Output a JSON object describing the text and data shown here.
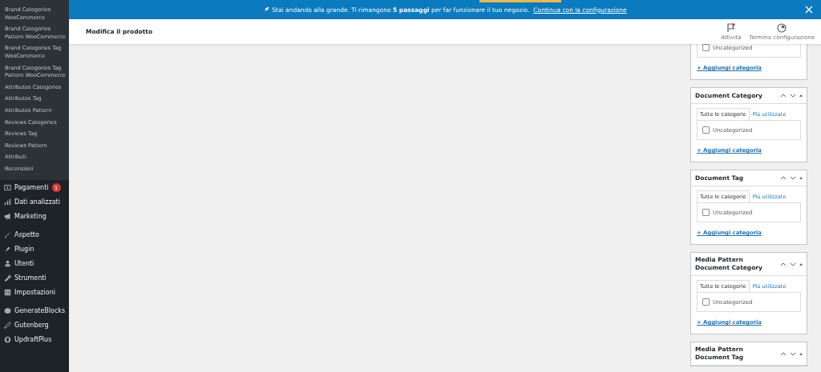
{
  "sidebar": {
    "submenu": [
      "Brand Categories WooCommerce",
      "Brand Categories Pattern WooCommerce",
      "Brand Categories Tag WooCommerce",
      "Brand Categories Tag Pattern WooCommerce",
      "Attributes Categories",
      "Attributes Tag",
      "Attributes Pattern",
      "Reviews Categories",
      "Reviews Tag",
      "Reviews Pattern",
      "Attributi",
      "Recensioni"
    ],
    "groups": [
      [
        {
          "label": "Pagamenti",
          "badge": "1"
        },
        {
          "label": "Dati analizzati"
        },
        {
          "label": "Marketing"
        }
      ],
      [
        {
          "label": "Aspetto"
        },
        {
          "label": "Plugin"
        },
        {
          "label": "Utenti"
        },
        {
          "label": "Strumenti"
        },
        {
          "label": "Impostazioni"
        }
      ],
      [
        {
          "label": "GenerateBlocks"
        },
        {
          "label": "Gutenberg"
        },
        {
          "label": "UpdraftPlus"
        }
      ]
    ]
  },
  "notice": {
    "text": "Stai andando alla grande. Ti rimangono **5 passaggi** per far funzionare il tuo negozio.",
    "link": "Continua con la configurazione"
  },
  "header": {
    "title": "Modifica il prodotto",
    "actions": [
      {
        "label": "Attività"
      },
      {
        "label": "Termina configurazione"
      }
    ]
  },
  "panels": [
    {
      "kind": "body_only",
      "items": [
        {
          "label": "Uncategorized",
          "checked": false
        }
      ],
      "add_link": "+ Aggiungi categoria"
    },
    {
      "kind": "full",
      "title": "Document Category",
      "tabs": [
        {
          "label": "Tutte le categorie",
          "selected": true
        },
        {
          "label": "Più utilizzate",
          "selected": false
        }
      ],
      "items": [
        {
          "label": "Uncategorized",
          "checked": false
        }
      ],
      "add_link": "+ Aggiungi categoria"
    },
    {
      "kind": "full",
      "title": "Document Tag",
      "tabs": [
        {
          "label": "Tutte le categorie",
          "selected": true
        },
        {
          "label": "Più utilizzate",
          "selected": false
        }
      ],
      "items": [
        {
          "label": "Uncategorized",
          "checked": false
        }
      ],
      "add_link": "+ Aggiungi categoria"
    },
    {
      "kind": "full",
      "title": "Media Pattern Document Category",
      "tabs": [
        {
          "label": "Tutte le categorie",
          "selected": true
        },
        {
          "label": "Più utilizzate",
          "selected": false
        }
      ],
      "items": [
        {
          "label": "Uncategorized",
          "checked": false
        }
      ],
      "add_link": "+ Aggiungi categoria"
    },
    {
      "kind": "header_only",
      "title": "Media Pattern Document Tag"
    }
  ]
}
